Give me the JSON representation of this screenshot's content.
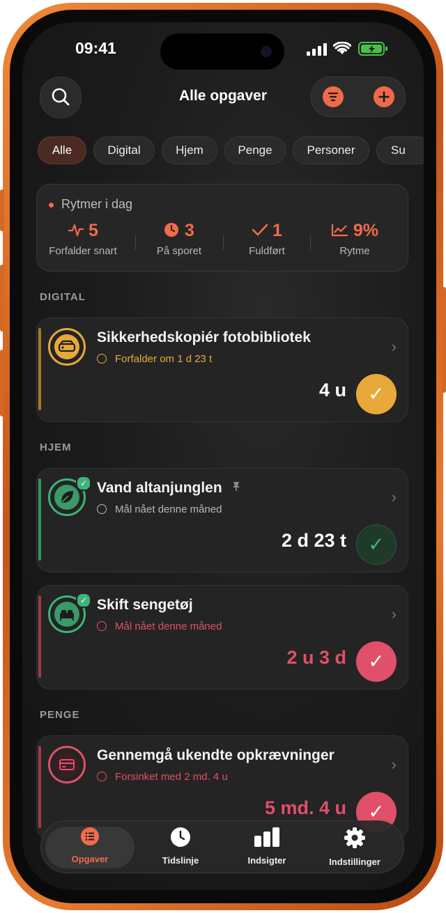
{
  "status_bar": {
    "time": "09:41"
  },
  "header": {
    "title": "Alle opgaver"
  },
  "filters": [
    "Alle",
    "Digital",
    "Hjem",
    "Penge",
    "Personer",
    "Su"
  ],
  "summary": {
    "title": "Rytmer i dag",
    "stats": [
      {
        "value": "5",
        "label": "Forfalder snart",
        "icon": "pulse-icon"
      },
      {
        "value": "3",
        "label": "På sporet",
        "icon": "clock-icon"
      },
      {
        "value": "1",
        "label": "Fuldført",
        "icon": "check-icon"
      },
      {
        "value": "9%",
        "label": "Rytme",
        "icon": "trend-icon"
      }
    ]
  },
  "sections": {
    "digital": "DIGITAL",
    "hjem": "HJEM",
    "penge": "PENGE"
  },
  "tasks": [
    {
      "name": "Sikkerhedskopiér fotobibliotek",
      "status": "Forfalder om 1 d 23 t",
      "amount": "4 u",
      "color": "#e8a93a",
      "icon": "drive-icon"
    },
    {
      "name": "Vand altanjunglen",
      "status": "Mål nået denne måned",
      "amount": "2 d 23 t",
      "color": "#3fb37a",
      "icon": "leaf-icon"
    },
    {
      "name": "Skift sengetøj",
      "status": "Mål nået denne måned",
      "amount": "2 u 3 d",
      "color": "#e05068",
      "icon": "bed-icon"
    },
    {
      "name": "Gennemgå ukendte opkrævninger",
      "status": "Forsinket med 2 md. 4 u",
      "amount": "5 md. 4 u",
      "color": "#e05068",
      "icon": "card-icon"
    }
  ],
  "tabs": [
    "Opgaver",
    "Tidslinje",
    "Indsigter",
    "Indstillinger"
  ],
  "colors": {
    "accent": "#f26b4b",
    "warning": "#e8a93a",
    "success": "#3fb37a",
    "danger": "#e05068",
    "frame": "#e0782e"
  }
}
